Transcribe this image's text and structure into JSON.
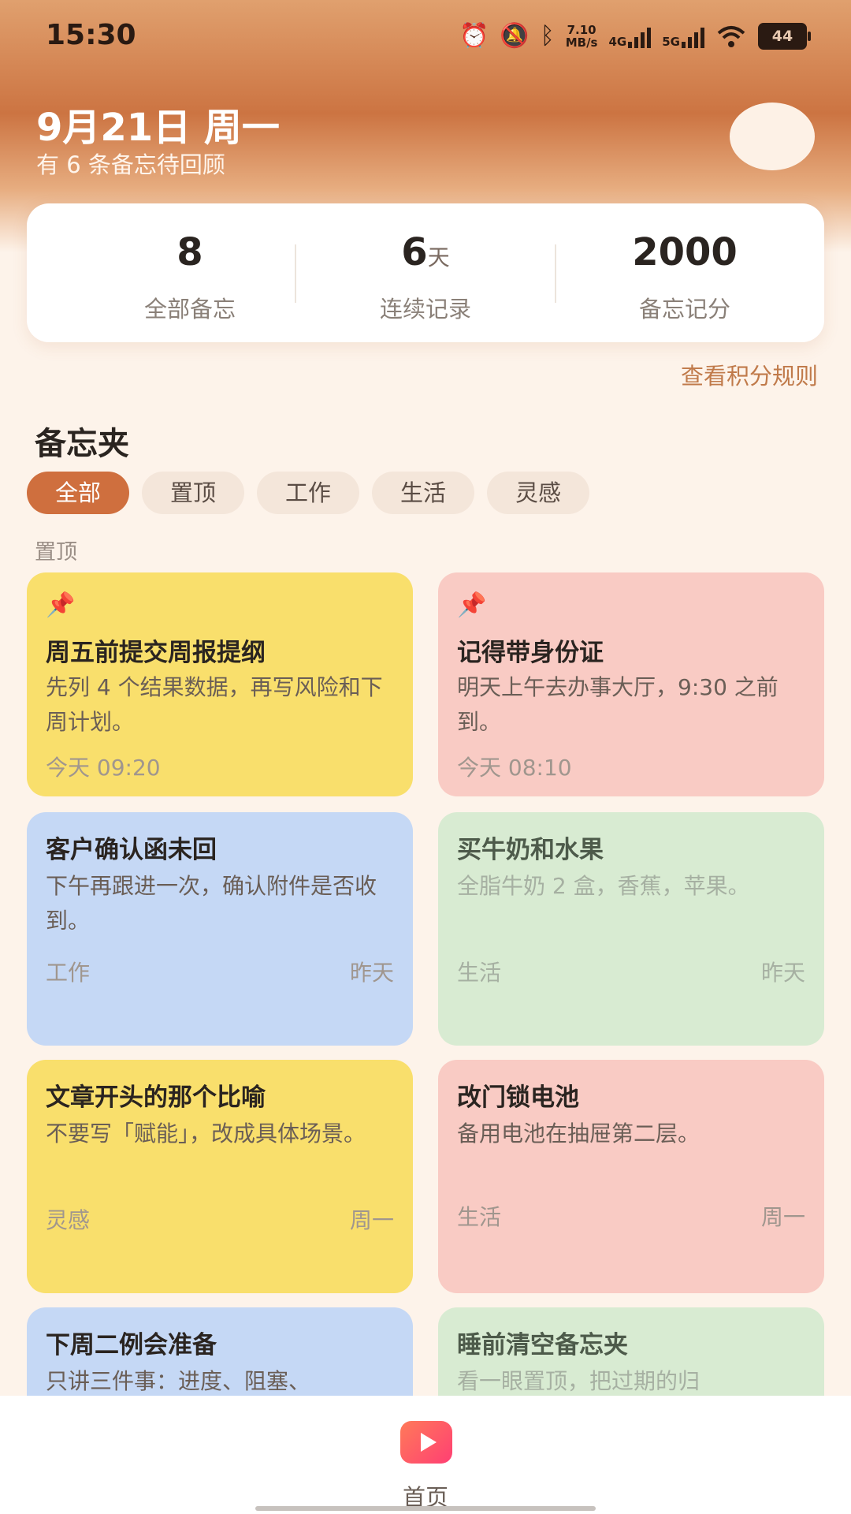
{
  "status_bar": {
    "time": "15:30",
    "net_speed_top": "7.10",
    "net_speed_bottom": "MB/s",
    "net1": "4G",
    "net2": "5G",
    "battery": "44",
    "icons": [
      "alarm-icon",
      "mute-icon",
      "bluetooth-icon",
      "signal-icon",
      "wifi-icon",
      "battery-icon"
    ]
  },
  "header": {
    "date": "9月21日 周一",
    "subtitle": "有 6 条备忘待回顾"
  },
  "stats": [
    {
      "value": "8",
      "unit": "",
      "label": "全部备忘"
    },
    {
      "value": "6",
      "unit": "天",
      "label": "连续记录"
    },
    {
      "value": "2000",
      "unit": "",
      "label": "备忘记分"
    }
  ],
  "rules_link": "查看积分规则",
  "folder": {
    "title": "备忘夹",
    "chips": [
      "全部",
      "置顶",
      "工作",
      "生活",
      "灵感"
    ],
    "active_chip": "全部",
    "pinned_label": "置顶"
  },
  "notes": [
    {
      "title": "周五前提交周报提纲",
      "body": "先列 4 个结果数据，再写风险和下周计划。",
      "meta": "今天 09:20",
      "date": "",
      "pinned": true,
      "color": "#f9df6c"
    },
    {
      "title": "记得带身份证",
      "body": "明天上午去办事大厅，9:30 之前到。",
      "meta": "今天 08:10",
      "date": "",
      "pinned": true,
      "color": "#f9cbc4"
    },
    {
      "title": "客户确认函未回",
      "body": "下午再跟进一次，确认附件是否收到。",
      "meta": "工作",
      "date": "昨天",
      "pinned": false,
      "color": "#c5d8f5"
    },
    {
      "title": "买牛奶和水果",
      "body": "全脂牛奶 2 盒，香蕉，苹果。",
      "meta": "生活",
      "date": "昨天",
      "pinned": false,
      "color": "#d8ebd2"
    },
    {
      "title": "文章开头的那个比喻",
      "body": "不要写「赋能」，改成具体场景。",
      "meta": "灵感",
      "date": "周一",
      "pinned": false,
      "color": "#f9df6c"
    },
    {
      "title": "改门锁电池",
      "body": "备用电池在抽屉第二层。",
      "meta": "生活",
      "date": "周一",
      "pinned": false,
      "color": "#f9cbc4"
    },
    {
      "title": "下周二例会准备",
      "body": "只讲三件事：进度、阻塞、",
      "meta": "",
      "date": "",
      "pinned": false,
      "color": "#c5d8f5"
    },
    {
      "title": "睡前清空备忘夹",
      "body": "看一眼置顶，把过期的归",
      "meta": "",
      "date": "",
      "pinned": false,
      "color": "#d8ebd2"
    }
  ],
  "bottom_nav": {
    "home_label": "首页",
    "home_icon": "play-icon"
  }
}
